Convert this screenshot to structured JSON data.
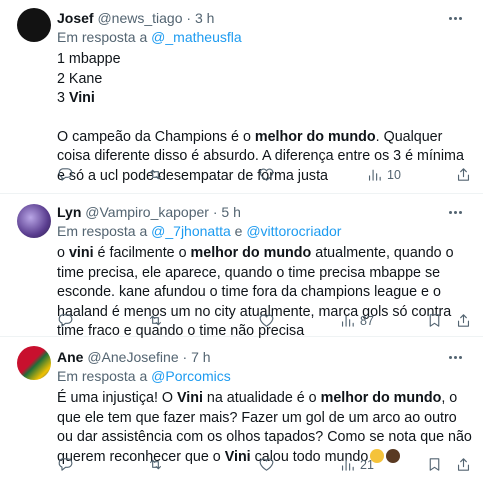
{
  "tweets": [
    {
      "name": "Josef",
      "handle": "@news_tiago",
      "sep": "·",
      "time": "3 h",
      "reply_prefix": "Em resposta a",
      "reply_to": "@_matheusfla",
      "lines": {
        "l1": "1 mbappe",
        "l2": "2 Kane",
        "l3a": "3 ",
        "l3b": "Vini"
      },
      "text": {
        "a": "O campeão da Champions é o ",
        "b": "melhor do mundo",
        "c": ". Qualquer coisa diferente disso é absurdo. A diferença entre os 3 é mínima e só a ucl pode desempatar de forma justa"
      },
      "views": "10",
      "avatar_color": "#121212"
    },
    {
      "name": "Lyn",
      "handle": "@Vampiro_kapoper",
      "sep": "·",
      "time": "5 h",
      "reply_prefix": "Em resposta a",
      "reply_to_1": "@_7jhonatta",
      "reply_and": "e",
      "reply_to_2": "@vittorocriador",
      "text": {
        "a": "o ",
        "b": "vini",
        "c": " é facilmente o ",
        "d": "melhor do mundo",
        "e": " atualmente, quando o time precisa, ele aparece, quando o time precisa mbappe se esconde. kane afundou o time fora da champions league e o haaland é menos um no city atualmente, marca gols só contra time fraco e quando o time não precisa"
      },
      "views": "87",
      "avatar_color": "#6a4a9a"
    },
    {
      "name": "Ane",
      "handle": "@AneJosefine",
      "sep": "·",
      "time": "7 h",
      "reply_prefix": "Em resposta a",
      "reply_to": "@Porcomics",
      "text": {
        "a": "É uma injustiça! O ",
        "b": "Vini",
        "c": " na atualidade é o ",
        "d": "melhor do mundo",
        "e": ", o que ele tem que fazer mais? Fazer um gol de um arco ao outro ou dar assistência com os olhos tapados? Como se nota que não querem reconhecer que o ",
        "f": "Vini",
        "g": " calou todo mundo"
      },
      "views": "21",
      "avatar_color": "#c8102e"
    }
  ],
  "icons": {
    "reply": "reply-icon",
    "retweet": "retweet-icon",
    "like": "heart-icon",
    "views": "views-icon",
    "share": "share-icon",
    "more": "more-icon"
  }
}
